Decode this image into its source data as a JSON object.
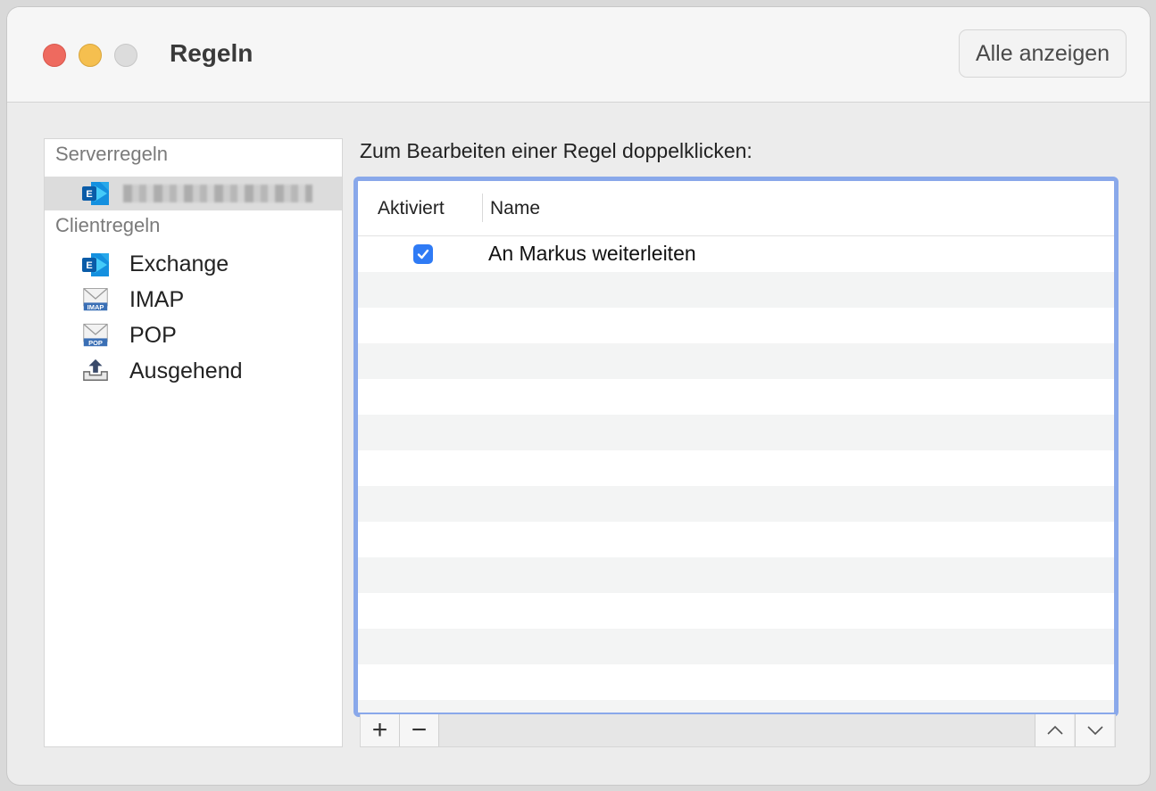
{
  "window": {
    "title": "Regeln",
    "show_all_label": "Alle anzeigen"
  },
  "sidebar": {
    "server_header": "Serverregeln",
    "server_account_icon": "exchange-icon",
    "client_header": "Clientregeln",
    "client_items": [
      {
        "label": "Exchange",
        "icon": "exchange-icon"
      },
      {
        "label": "IMAP",
        "icon": "imap-mail-icon"
      },
      {
        "label": "POP",
        "icon": "pop-mail-icon"
      },
      {
        "label": "Ausgehend",
        "icon": "outbox-icon"
      }
    ]
  },
  "main": {
    "instruction": "Zum Bearbeiten einer Regel doppelklicken:",
    "columns": [
      "Aktiviert",
      "Name"
    ],
    "rules": [
      {
        "enabled": true,
        "name": "An Markus weiterleiten"
      }
    ],
    "add_label": "+",
    "remove_label": "−"
  },
  "colors": {
    "focus_ring": "#89a8ea",
    "checkbox": "#2f7bf5",
    "close": "#ee6a5f",
    "minimize": "#f5bf4f"
  }
}
